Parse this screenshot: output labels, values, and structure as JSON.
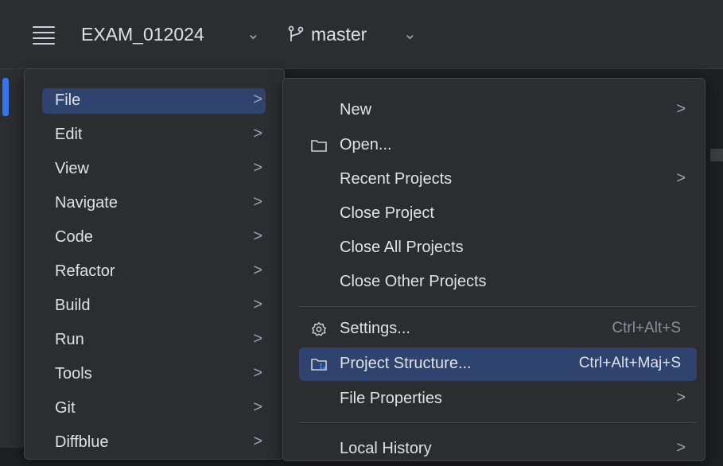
{
  "header": {
    "project_name": "EXAM_012024",
    "project_chevron": "⌄",
    "branch_name": "master",
    "branch_chevron": "⌄",
    "icons": [
      "hamburger-menu-icon",
      "git-branch-icon"
    ]
  },
  "main_menu": {
    "items": [
      {
        "label": "File",
        "arrow": ">",
        "selected": true
      },
      {
        "label": "Edit",
        "arrow": ">"
      },
      {
        "label": "View",
        "arrow": ">"
      },
      {
        "label": "Navigate",
        "arrow": ">"
      },
      {
        "label": "Code",
        "arrow": ">"
      },
      {
        "label": "Refactor",
        "arrow": ">"
      },
      {
        "label": "Build",
        "arrow": ">"
      },
      {
        "label": "Run",
        "arrow": ">"
      },
      {
        "label": "Tools",
        "arrow": ">"
      },
      {
        "label": "Git",
        "arrow": ">"
      },
      {
        "label": "Diffblue",
        "arrow": ">"
      }
    ]
  },
  "file_submenu": {
    "items": [
      {
        "label": "New",
        "arrow": ">"
      },
      {
        "label": "Open...",
        "icon": "folder-icon"
      },
      {
        "label": "Recent Projects",
        "arrow": ">"
      },
      {
        "label": "Close Project"
      },
      {
        "label": "Close All Projects"
      },
      {
        "label": "Close Other Projects"
      },
      {
        "label": "Settings...",
        "icon": "gear-icon",
        "shortcut": "Ctrl+Alt+S"
      },
      {
        "label": "Project Structure...",
        "icon": "project-structure-icon",
        "shortcut": "Ctrl+Alt+Maj+S",
        "selected": true
      },
      {
        "label": "File Properties",
        "arrow": ">"
      },
      {
        "label": "Local History",
        "arrow": ">"
      }
    ]
  },
  "colors": {
    "background": "#1e1f22",
    "panel": "#2b2d30",
    "selection": "#2e436e",
    "accent": "#3574f0",
    "text": "#dfe1e5"
  }
}
